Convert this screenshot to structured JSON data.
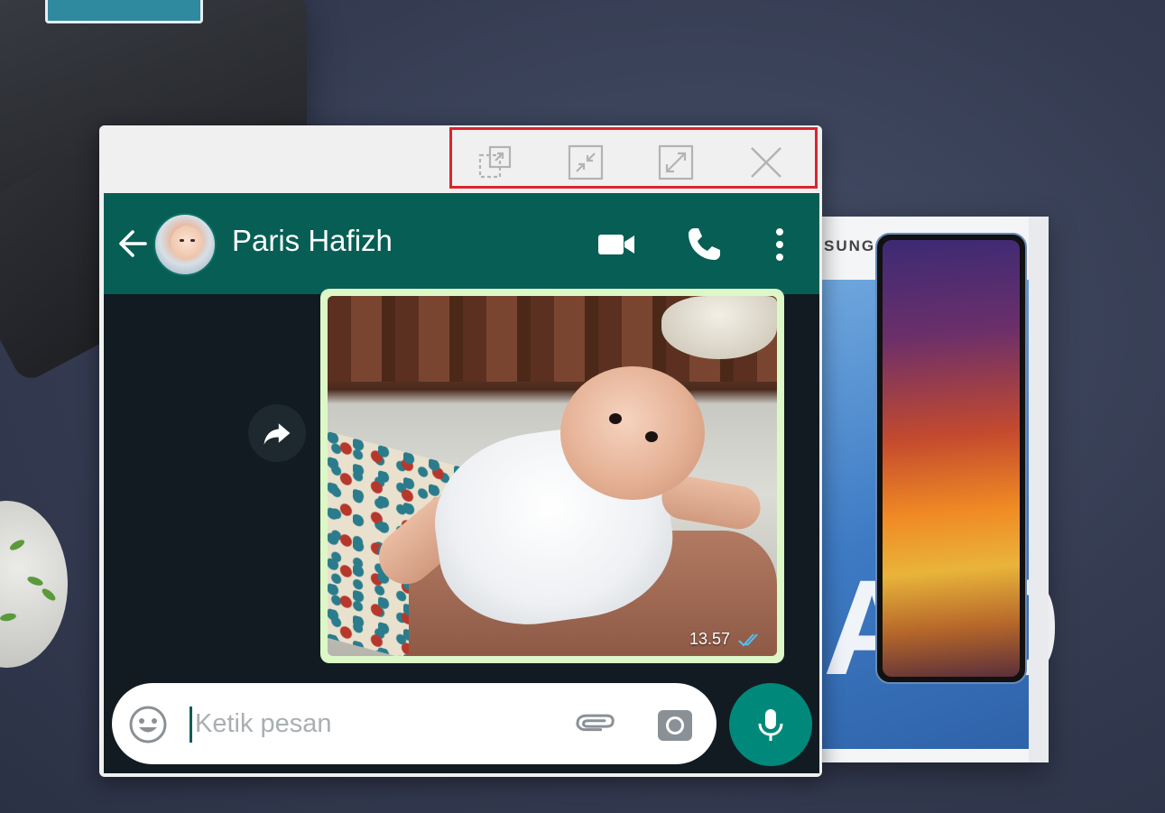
{
  "window": {
    "controls": [
      {
        "name": "resize-icon"
      },
      {
        "name": "minimize-icon"
      },
      {
        "name": "maximize-icon"
      },
      {
        "name": "close-icon"
      }
    ],
    "highlight_color": "#d9252f"
  },
  "chat": {
    "contact_name": "Paris Hafizh",
    "header_color": "#075e54",
    "header_icons": [
      "video-call-icon",
      "voice-call-icon",
      "more-options-icon"
    ]
  },
  "message": {
    "time": "13.57",
    "status": "read",
    "tick_color": "#4fc3f7"
  },
  "composer": {
    "placeholder": "Ketik pesan",
    "mic_color": "#00897b"
  },
  "background": {
    "brand_text": "SUNG",
    "model_text": "A50"
  }
}
